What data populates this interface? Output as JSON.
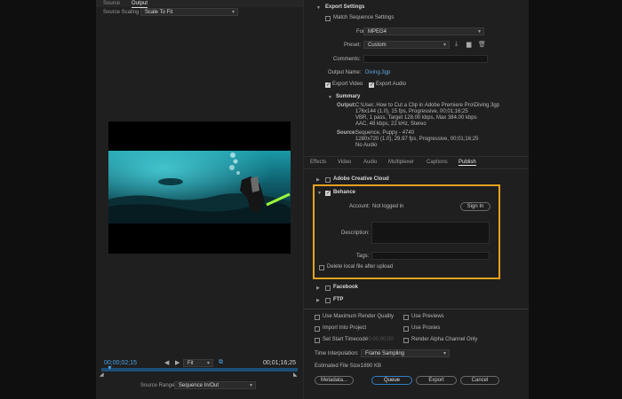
{
  "left": {
    "tabs": [
      "Source",
      "Output"
    ],
    "source_scaling_label": "Source Scaling",
    "source_scaling_value": "Scale To Fit",
    "timecode_current": "00;00;02;15",
    "fit_value": "Fit",
    "timecode_end": "00;01;16;25",
    "source_range_label": "Source Range:",
    "source_range_value": "Sequence In/Out"
  },
  "right": {
    "export_settings_title": "Export Settings",
    "match_sequence_label": "Match Sequence Settings",
    "format_label": "Format:",
    "format_value": "MPEG4",
    "preset_label": "Preset:",
    "preset_value": "Custom",
    "comments_label": "Comments:",
    "output_name_label": "Output Name:",
    "output_name_value": "Diving.3gp",
    "export_video_label": "Export Video",
    "export_audio_label": "Export Audio",
    "summary_title": "Summary",
    "output_label": "Output:",
    "output_lines": [
      "C:\\User..How to Cut a Clip in Adobe Premiere Pro\\Diving.3gp",
      "176x144 (1.0), 15 fps, Progressive, 00;01;16;25",
      "VBR, 1 pass, Target 128.00 kbps, Max 384.00 kbps",
      "AAC, 48 kbps, 22 kHz, Stereo"
    ],
    "source_label": "Source:",
    "source_lines": [
      "Sequence, Puppy - 4740",
      "1280x720 (1.0), 29.97 fps, Progressive, 00;01;16;25",
      "No Audio"
    ],
    "tabs": [
      "Effects",
      "Video",
      "Audio",
      "Multiplexer",
      "Captions",
      "Publish"
    ],
    "creative_cloud_label": "Adobe Creative Cloud",
    "behance_label": "Behance",
    "account_label": "Account:",
    "account_value": "Not logged in",
    "sign_in_label": "Sign In",
    "description_label": "Description:",
    "tags_label": "Tags:",
    "delete_local_label": "Delete local file after upload",
    "facebook_label": "Facebook",
    "ftp_label": "FTP",
    "use_max_render_label": "Use Maximum Render Quality",
    "use_previews_label": "Use Previews",
    "import_into_project_label": "Import Into Project",
    "use_proxies_label": "Use Proxies",
    "set_start_timecode_label": "Set Start Timecode",
    "start_timecode_value": "00;00;00;00",
    "render_alpha_label": "Render Alpha Channel Only",
    "time_interpolation_label": "Time Interpolation:",
    "time_interpolation_value": "Frame Sampling",
    "estimated_size_label": "Estimated File Size:",
    "estimated_size_value": "1690 KB",
    "metadata_label": "Metadata...",
    "queue_label": "Queue",
    "export_label": "Export",
    "cancel_label": "Cancel"
  },
  "colors": {
    "highlight": "#e8a21d",
    "link": "#5ea6e6",
    "timecode": "#4aa3e8",
    "primary_button": "#2e7fc7"
  }
}
